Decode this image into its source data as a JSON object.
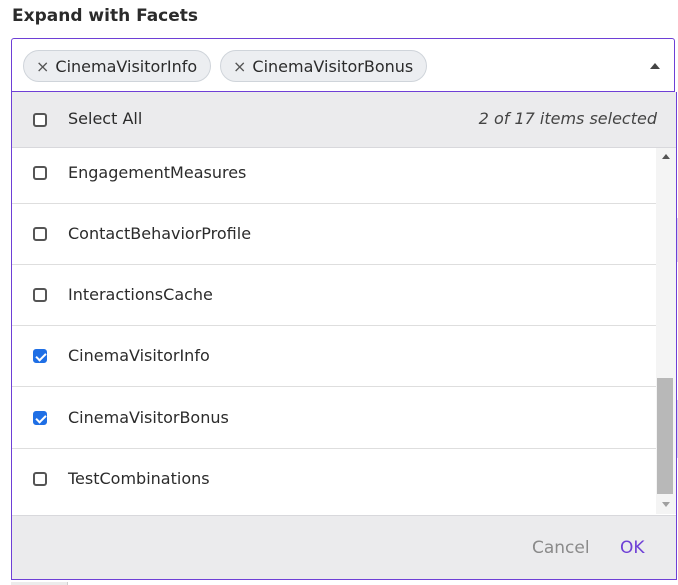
{
  "field": {
    "label": "Expand with Facets"
  },
  "chips": [
    {
      "label": "CinemaVisitorInfo",
      "remove_icon": "×"
    },
    {
      "label": "CinemaVisitorBonus",
      "remove_icon": "×"
    }
  ],
  "header": {
    "select_all_label": "Select All",
    "count_text": "2 of 17 items selected"
  },
  "items": [
    {
      "label": "EngagementMeasures",
      "checked": false
    },
    {
      "label": "ContactBehaviorProfile",
      "checked": false
    },
    {
      "label": "InteractionsCache",
      "checked": false
    },
    {
      "label": "CinemaVisitorInfo",
      "checked": true
    },
    {
      "label": "CinemaVisitorBonus",
      "checked": true
    },
    {
      "label": "TestCombinations",
      "checked": false
    }
  ],
  "footer": {
    "cancel_label": "Cancel",
    "ok_label": "OK"
  },
  "colors": {
    "accent": "#6e3fd6",
    "checkbox_checked": "#1f6fe5"
  }
}
